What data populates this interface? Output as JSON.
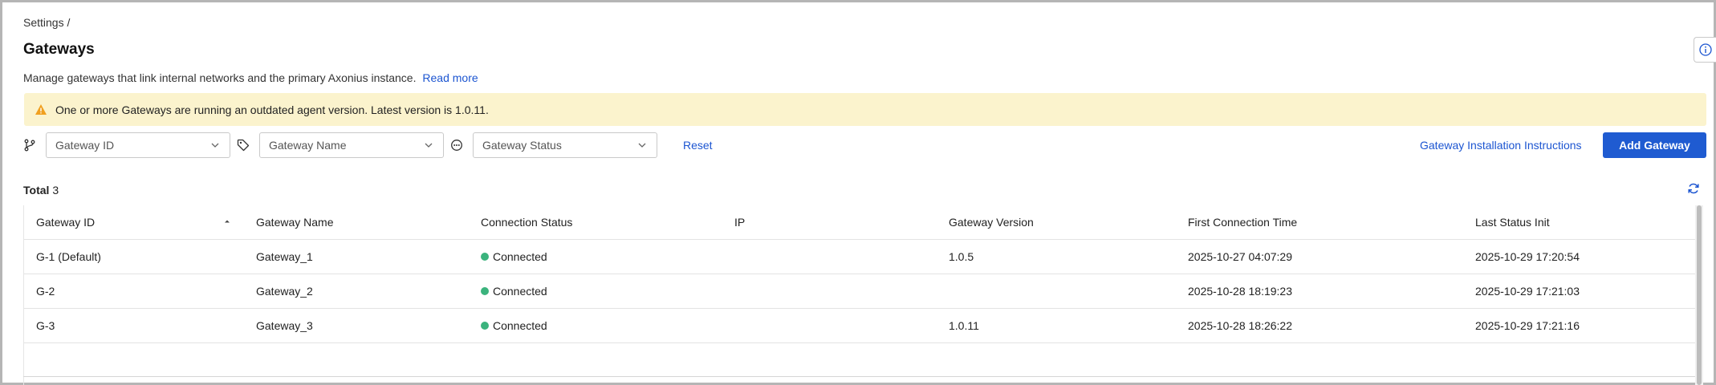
{
  "breadcrumb": "Settings /",
  "title": "Gateways",
  "description": "Manage gateways that link internal networks and the primary Axonius instance.",
  "read_more": "Read more",
  "banner": {
    "text": "One or more Gateways are running an outdated agent version. Latest version is 1.0.11.",
    "icon": "warning-icon",
    "color": "#fbf3cd"
  },
  "filters": {
    "gateway_id_placeholder": "Gateway ID",
    "gateway_name_placeholder": "Gateway Name",
    "gateway_status_placeholder": "Gateway Status",
    "reset": "Reset"
  },
  "actions": {
    "install_instructions": "Gateway Installation Instructions",
    "add_gateway": "Add Gateway"
  },
  "total": {
    "label": "Total",
    "count": "3"
  },
  "table": {
    "columns": [
      "Gateway ID",
      "Gateway Name",
      "Connection Status",
      "IP",
      "Gateway Version",
      "First Connection Time",
      "Last Status Init"
    ],
    "rows": [
      {
        "id": "G-1 (Default)",
        "name": "Gateway_1",
        "status": "Connected",
        "ip": "",
        "version": "1.0.5",
        "first": "2025-10-27 04:07:29",
        "last": "2025-10-29 17:20:54"
      },
      {
        "id": "G-2",
        "name": "Gateway_2",
        "status": "Connected",
        "ip": "",
        "version": "",
        "first": "2025-10-28 18:19:23",
        "last": "2025-10-29 17:21:03"
      },
      {
        "id": "G-3",
        "name": "Gateway_3",
        "status": "Connected",
        "ip": "",
        "version": "1.0.11",
        "first": "2025-10-28 18:26:22",
        "last": "2025-10-29 17:21:16"
      }
    ]
  },
  "colors": {
    "accent": "#1f5bd1",
    "link": "#1c55d1",
    "connected": "#3bb37d"
  }
}
